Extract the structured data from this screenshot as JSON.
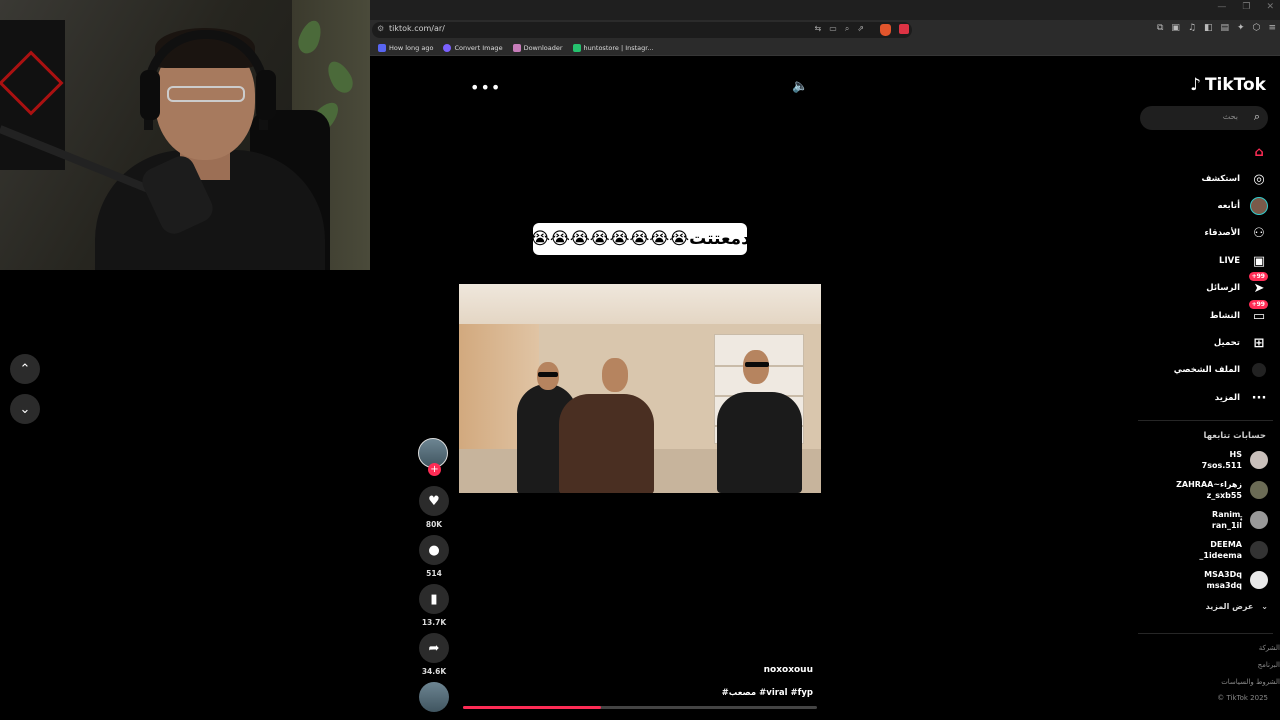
{
  "browser": {
    "url": "tiktok.com/ar/",
    "bookmarks": [
      "How long ago",
      "Convert Image",
      "Downloader",
      "huntostore | Instagr..."
    ],
    "extension_badge": "1"
  },
  "video": {
    "caption": "دمعتتت😭😭😭😭😭😭😭😭",
    "author": "noxoxouu",
    "description": "#مصعب #viral #fyp",
    "progress": 0.39,
    "likes": "80K",
    "comments": "514",
    "saves": "13.7K",
    "shares": "34.6K"
  },
  "sidebar": {
    "logo": "TikTok",
    "search_placeholder": "بحث",
    "nav": [
      {
        "label": "",
        "icon": "home-icon",
        "active": true
      },
      {
        "label": "استكشف",
        "icon": "compass-icon"
      },
      {
        "label": "أتابعه",
        "icon": "following-avatar-icon"
      },
      {
        "label": "الأصدقاء",
        "icon": "friends-icon"
      },
      {
        "label": "LIVE",
        "icon": "live-icon"
      },
      {
        "label": "الرسائل",
        "icon": "messages-icon",
        "badge": "+99"
      },
      {
        "label": "النشاط",
        "icon": "activity-icon",
        "badge": "+99"
      },
      {
        "label": "تحميل",
        "icon": "upload-icon"
      },
      {
        "label": "الملف الشخصي",
        "icon": "profile-icon"
      },
      {
        "label": "المزيد",
        "icon": "more-icon"
      }
    ],
    "following_title": "حسابات تتابعها",
    "accounts": [
      {
        "name": "HS",
        "handle": "7sos.511"
      },
      {
        "name": "ZAHRAA~زهراء",
        "handle": "z_sxb55"
      },
      {
        "name": "Ranimـ۪ٜ",
        "handle": "ran_1il"
      },
      {
        "name": "DEEMA",
        "handle": "_1ideema"
      },
      {
        "name": "MSA3Dq",
        "handle": "msa3dq"
      }
    ],
    "show_more": "عرض المزيد",
    "footer": [
      "الشركة",
      "البرنامج",
      "الشروط والسياسات",
      "© TikTok 2025"
    ]
  },
  "colors": {
    "accent": "#fe2c55",
    "bg": "#000000"
  }
}
